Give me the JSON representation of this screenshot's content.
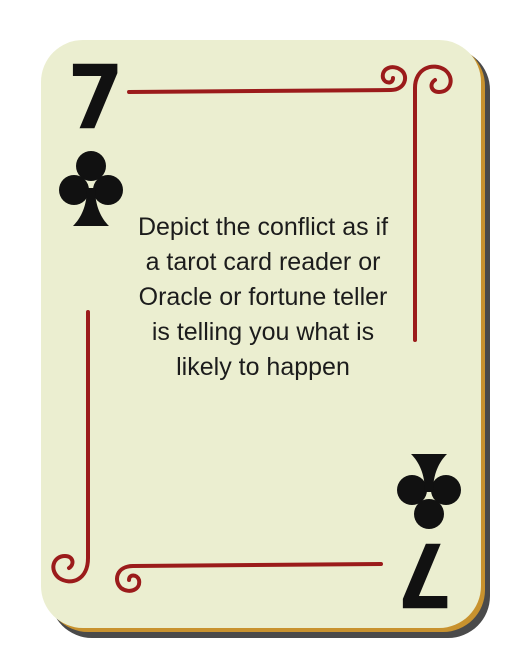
{
  "card": {
    "rank": "7",
    "suit": "club",
    "suit_icon": "club-icon",
    "prompt": "Depict the conflict as if a tarot card reader or Oracle or fortune teller is telling you what is likely to happen"
  },
  "colors": {
    "card_face": "#ebeed0",
    "card_edge": "#c8922e",
    "shadow": "#4a4a4a",
    "ink": "#111111",
    "flourish": "#9b1b1b"
  }
}
